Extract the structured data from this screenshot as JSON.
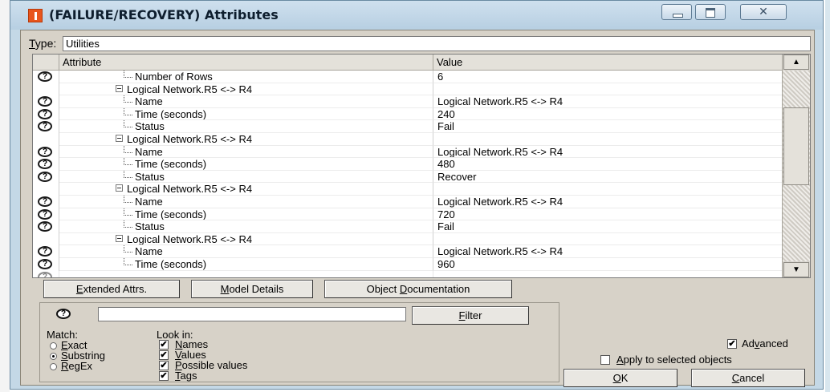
{
  "window": {
    "title": "(FAILURE/RECOVERY) Attributes",
    "close_glyph": "✕"
  },
  "type_field": {
    "label_prefix": "",
    "label_underlined": "T",
    "label_rest": "ype:",
    "value": "Utilities"
  },
  "table": {
    "headers": {
      "attribute": "Attribute",
      "value": "Value"
    },
    "rows": [
      {
        "kind": "leaf",
        "help": true,
        "attribute": "Number of Rows",
        "value": "6"
      },
      {
        "kind": "group",
        "help": false,
        "attribute": "Logical Network.R5 <-> R4",
        "value": ""
      },
      {
        "kind": "leaf",
        "help": true,
        "attribute": "Name",
        "value": "Logical Network.R5 <-> R4"
      },
      {
        "kind": "leaf",
        "help": true,
        "attribute": "Time (seconds)",
        "value": "240"
      },
      {
        "kind": "leaf",
        "help": true,
        "attribute": "Status",
        "value": "Fail"
      },
      {
        "kind": "group",
        "help": false,
        "attribute": "Logical Network.R5 <-> R4",
        "value": ""
      },
      {
        "kind": "leaf",
        "help": true,
        "attribute": "Name",
        "value": "Logical Network.R5 <-> R4"
      },
      {
        "kind": "leaf",
        "help": true,
        "attribute": "Time (seconds)",
        "value": "480"
      },
      {
        "kind": "leaf",
        "help": true,
        "attribute": "Status",
        "value": "Recover"
      },
      {
        "kind": "group",
        "help": false,
        "attribute": "Logical Network.R5 <-> R4",
        "value": ""
      },
      {
        "kind": "leaf",
        "help": true,
        "attribute": "Name",
        "value": "Logical Network.R5 <-> R4"
      },
      {
        "kind": "leaf",
        "help": true,
        "attribute": "Time (seconds)",
        "value": "720"
      },
      {
        "kind": "leaf",
        "help": true,
        "attribute": "Status",
        "value": "Fail"
      },
      {
        "kind": "group",
        "help": false,
        "attribute": "Logical Network.R5 <-> R4",
        "value": ""
      },
      {
        "kind": "leaf",
        "help": true,
        "attribute": "Name",
        "value": "Logical Network.R5 <-> R4"
      },
      {
        "kind": "leaf",
        "help": true,
        "attribute": "Time (seconds)",
        "value": "960"
      },
      {
        "kind": "partial",
        "help": true,
        "attribute": "",
        "value": ""
      }
    ],
    "scroll_up_glyph": "▲",
    "scroll_down_glyph": "▼"
  },
  "buttons": {
    "extended_attrs": {
      "u": "E",
      "rest": "xtended Attrs."
    },
    "model_details": {
      "u": "M",
      "rest": "odel Details"
    },
    "object_documentation": {
      "pre": "Object ",
      "u": "D",
      "rest": "ocumentation"
    },
    "filter": {
      "u": "F",
      "rest": "ilter"
    },
    "ok": {
      "u": "O",
      "rest": "K"
    },
    "cancel": {
      "u": "C",
      "rest": "ancel"
    }
  },
  "filter": {
    "help_glyph": "?",
    "search_value": "",
    "match_label": "Match:",
    "match_options": [
      {
        "u": "E",
        "rest": "xact",
        "selected": false
      },
      {
        "u": "S",
        "rest": "ubstring",
        "selected": true
      },
      {
        "u": "R",
        "rest": "egEx",
        "selected": false
      }
    ],
    "look_in_label": "Look in:",
    "look_in_options": [
      {
        "u": "N",
        "rest": "ames",
        "checked": true
      },
      {
        "u": "V",
        "rest": "alues",
        "checked": true
      },
      {
        "u": "P",
        "rest": "ossible values",
        "checked": true
      },
      {
        "u": "T",
        "rest": "ags",
        "checked": true
      }
    ]
  },
  "options": {
    "advanced": {
      "pre": "Ad",
      "u": "v",
      "rest": "anced",
      "checked": true
    },
    "apply_selected": {
      "pre": "",
      "u": "A",
      "rest": "pply to selected objects",
      "checked": false
    }
  },
  "help_icon_glyph": "?",
  "check_glyph": "✔"
}
